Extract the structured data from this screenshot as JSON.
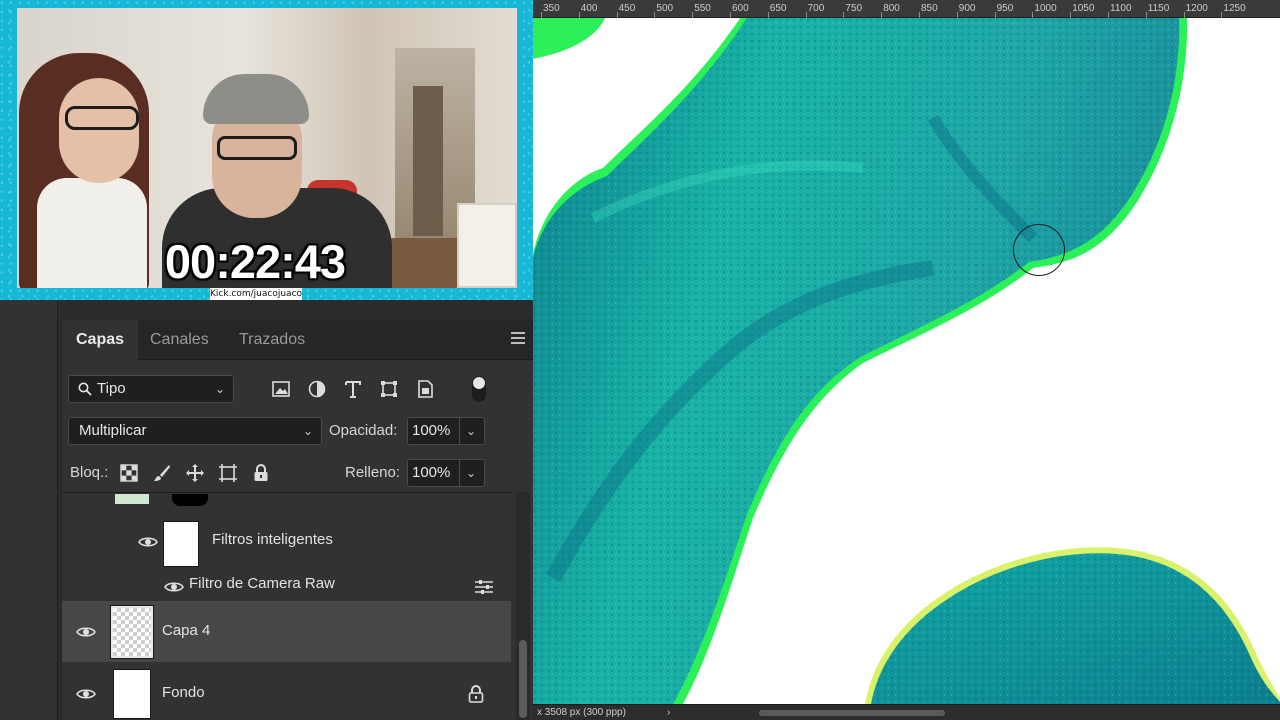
{
  "webcam": {
    "timer": "00:22:43",
    "url": "Kick.com/juacojuaco"
  },
  "layers_panel": {
    "tabs": [
      {
        "label": "Capas",
        "active": true
      },
      {
        "label": "Canales",
        "active": false
      },
      {
        "label": "Trazados",
        "active": false
      }
    ],
    "filter": {
      "kind": "Tipo",
      "icon": "search-icon"
    },
    "blend_mode": "Multiplicar",
    "opacity_label": "Opacidad:",
    "opacity_value": "100%",
    "lock_label": "Bloq.:",
    "fill_label": "Relleno:",
    "fill_value": "100%",
    "layers": [
      {
        "name": "Filtros inteligentes",
        "visible": true,
        "type": "smart-filter-mask"
      },
      {
        "name": "Filtro de Camera Raw",
        "visible": true,
        "type": "smart-filter"
      },
      {
        "name": "Capa 4",
        "visible": true,
        "type": "pixel",
        "selected": true
      },
      {
        "name": "Fondo",
        "visible": true,
        "type": "background",
        "locked": true
      }
    ]
  },
  "canvas": {
    "ruler_labels": [
      "350",
      "400",
      "450",
      "500",
      "550",
      "600",
      "650",
      "700",
      "750",
      "800",
      "850",
      "900",
      "950",
      "1000",
      "1050",
      "1100",
      "1150",
      "1200",
      "1250"
    ],
    "status_text": "x 3508 px (300 ppp)",
    "status_arrow": "›"
  },
  "colors": {
    "accent_teal": "#16b8d6",
    "artwork_teal": "#18a8a0",
    "artwork_green": "#2cf05a",
    "ps_panel": "#323232"
  }
}
